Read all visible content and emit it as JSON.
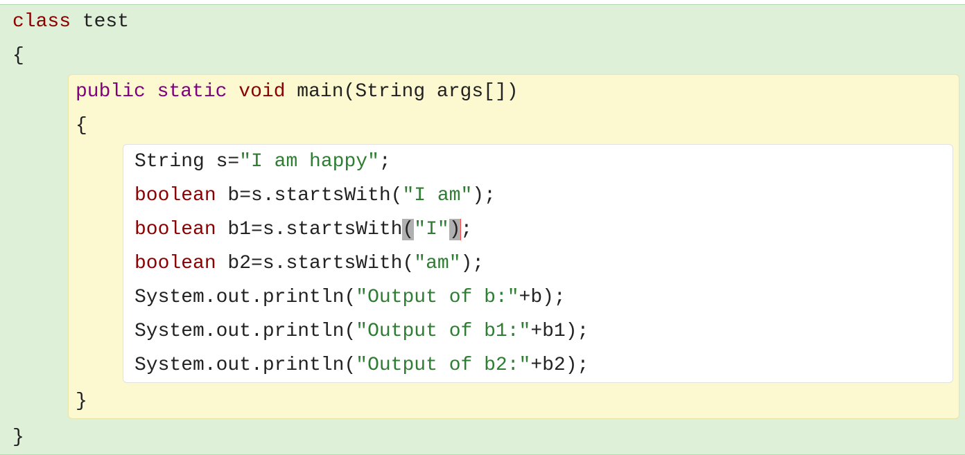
{
  "outer": {
    "line1_kw": "class",
    "line1_rest": " test",
    "open": "{",
    "close": "}"
  },
  "method": {
    "mod1": "public",
    "mod2": "static",
    "ret": "void",
    "sig_rest": " main(String args[])",
    "open": "{",
    "close": "}"
  },
  "body": {
    "l1_a": "String s=",
    "l1_s": "\"I am happy\"",
    "l1_b": ";",
    "l2_kw": "boolean",
    "l2_a": " b=s.startsWith(",
    "l2_s": "\"I am\"",
    "l2_b": ");",
    "l3_kw": "boolean",
    "l3_a": " b1=s.startsWith",
    "l3_p1": "(",
    "l3_s": "\"I\"",
    "l3_p2": ")",
    "l3_b": ";",
    "l4_kw": "boolean",
    "l4_a": " b2=s.startsWith(",
    "l4_s": "\"am\"",
    "l4_b": ");",
    "l5_a": "System.out.println(",
    "l5_s": "\"Output of b:\"",
    "l5_b": "+b);",
    "l6_a": "System.out.println(",
    "l6_s": "\"Output of b1:\"",
    "l6_b": "+b1);",
    "l7_a": "System.out.println(",
    "l7_s": "\"Output of b2:\"",
    "l7_b": "+b2);"
  }
}
